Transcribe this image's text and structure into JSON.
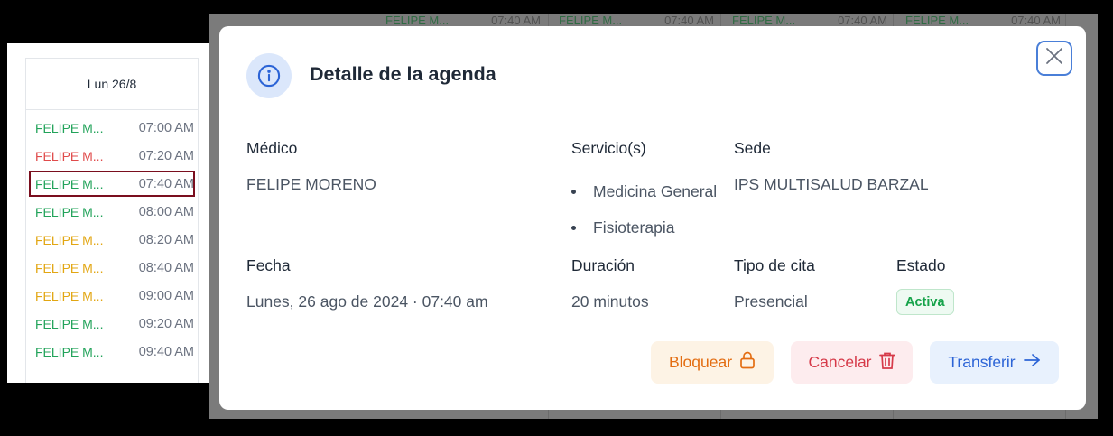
{
  "calendar": {
    "day_header": "Lun 26/8",
    "slots": [
      {
        "name": "FELIPE M...",
        "time": "07:00 AM",
        "color": "#22a35a"
      },
      {
        "name": "FELIPE M...",
        "time": "07:20 AM",
        "color": "#e04b4b"
      },
      {
        "name": "FELIPE M...",
        "time": "07:40 AM",
        "color": "#22a35a",
        "selected": true
      },
      {
        "name": "FELIPE M...",
        "time": "08:00 AM",
        "color": "#22a35a"
      },
      {
        "name": "FELIPE M...",
        "time": "08:20 AM",
        "color": "#e2a612"
      },
      {
        "name": "FELIPE M...",
        "time": "08:40 AM",
        "color": "#e2a612"
      },
      {
        "name": "FELIPE M...",
        "time": "09:00 AM",
        "color": "#e2a612"
      },
      {
        "name": "FELIPE M...",
        "time": "09:20 AM",
        "color": "#22a35a"
      },
      {
        "name": "FELIPE M...",
        "time": "09:40 AM",
        "color": "#22a35a"
      }
    ],
    "background_row": [
      {
        "name": "FELIPE M...",
        "time": "07:40 AM"
      },
      {
        "name": "FELIPE M...",
        "time": "07:40 AM"
      },
      {
        "name": "FELIPE M...",
        "time": "07:40 AM"
      },
      {
        "name": "FELIPE M...",
        "time": "07:40 AM"
      }
    ]
  },
  "modal": {
    "title": "Detalle de la agenda",
    "labels": {
      "doctor": "Médico",
      "services": "Servicio(s)",
      "site": "Sede",
      "date": "Fecha",
      "duration": "Duración",
      "appointment_type": "Tipo de cita",
      "status": "Estado"
    },
    "values": {
      "doctor": "FELIPE MORENO",
      "services": [
        "Medicina General",
        "Fisioterapia"
      ],
      "site": "IPS MULTISALUD BARZAL",
      "date": "Lunes, 26 ago de 2024 · 07:40 am",
      "duration": "20 minutos",
      "appointment_type": "Presencial",
      "status": "Activa"
    },
    "buttons": {
      "block": "Bloquear",
      "cancel": "Cancelar",
      "transfer": "Transferir"
    },
    "icons": [
      "info-icon",
      "close-icon",
      "lock-icon",
      "trash-icon",
      "arrow-right-icon"
    ]
  },
  "colors": {
    "accent_blue": "#2c64d6",
    "status_green": "#16a34a",
    "block_orange": "#e36d12",
    "cancel_red": "#d63a49",
    "selection_border": "#7a0e1e"
  }
}
